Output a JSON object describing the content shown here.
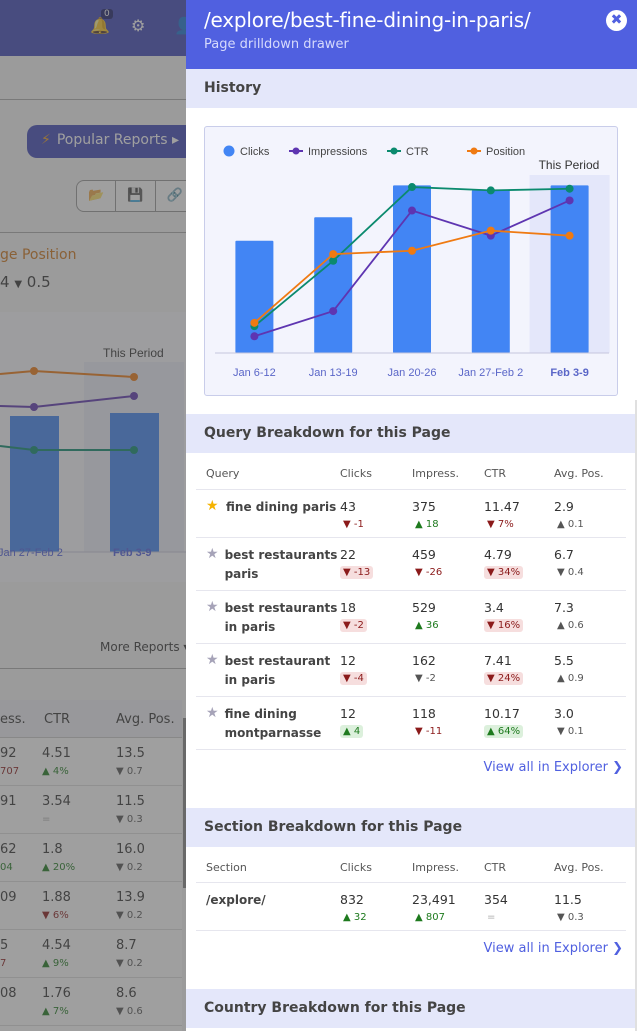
{
  "background": {
    "notifications_count": "0",
    "icons": [
      "bell-icon",
      "gear-icon",
      "user-icon"
    ],
    "popular_reports_label": "Popular Reports",
    "toolbar_icons": [
      "folder-open-icon",
      "save-icon",
      "link-icon"
    ],
    "avg_position_label": "ge Position",
    "avg_position_delta": "0.5",
    "chart": {
      "this_period_label": "This Period",
      "x_labels": [
        "Jan 27-Feb 2",
        "Feb 3-9"
      ]
    },
    "more_reports_label": "More Reports",
    "table": {
      "headers": [
        "ess.",
        "CTR",
        "Avg. Pos."
      ],
      "rows": [
        {
          "impress": "92",
          "impress_delta": "707",
          "ctr": "4.51",
          "ctr_delta": "4%",
          "ctr_dir": "up",
          "pos": "13.5",
          "pos_delta": "0.7"
        },
        {
          "impress": "91",
          "impress_delta": "",
          "ctr": "3.54",
          "ctr_delta": "=",
          "ctr_dir": "eq",
          "pos": "11.5",
          "pos_delta": "0.3"
        },
        {
          "impress": "62",
          "impress_delta": "04",
          "ctr": "1.8",
          "ctr_delta": "20%",
          "ctr_dir": "up",
          "pos": "16.0",
          "pos_delta": "0.2"
        },
        {
          "impress": "09",
          "impress_delta": "",
          "ctr": "1.88",
          "ctr_delta": "6%",
          "ctr_dir": "down",
          "pos": "13.9",
          "pos_delta": "0.2"
        },
        {
          "impress": "5",
          "impress_delta": "7",
          "ctr": "4.54",
          "ctr_delta": "9%",
          "ctr_dir": "up",
          "pos": "8.7",
          "pos_delta": "0.2"
        },
        {
          "impress": "08",
          "impress_delta": "",
          "ctr": "1.76",
          "ctr_delta": "7%",
          "ctr_dir": "up",
          "pos": "8.6",
          "pos_delta": "0.6"
        }
      ]
    }
  },
  "drawer": {
    "title": "/explore/best-fine-dining-in-paris/",
    "subtitle": "Page drilldown drawer",
    "close_icon": "close-circle-icon",
    "history": {
      "heading": "History"
    },
    "query_breakdown": {
      "heading": "Query Breakdown for this Page",
      "headers": [
        "Query",
        "Clicks",
        "Impress.",
        "CTR",
        "Avg. Pos."
      ],
      "rows": [
        {
          "query": "fine dining paris",
          "starred": true,
          "clicks": "43",
          "clicks_delta": "-1",
          "clicks_dir": "down",
          "clicks_hl": false,
          "impress": "375",
          "impress_delta": "18",
          "impress_dir": "up",
          "impress_hl": false,
          "ctr": "11.47",
          "ctr_delta": "7%",
          "ctr_dir": "down",
          "ctr_hl": false,
          "pos": "2.9",
          "pos_delta": "0.1",
          "pos_dir": "up"
        },
        {
          "query": "best restaurants paris",
          "starred": false,
          "clicks": "22",
          "clicks_delta": "-13",
          "clicks_dir": "down",
          "clicks_hl": true,
          "impress": "459",
          "impress_delta": "-26",
          "impress_dir": "down",
          "impress_hl": false,
          "ctr": "4.79",
          "ctr_delta": "34%",
          "ctr_dir": "down",
          "ctr_hl": true,
          "pos": "6.7",
          "pos_delta": "0.4",
          "pos_dir": "down"
        },
        {
          "query": "best restaurants in paris",
          "starred": false,
          "clicks": "18",
          "clicks_delta": "-2",
          "clicks_dir": "down",
          "clicks_hl": true,
          "impress": "529",
          "impress_delta": "36",
          "impress_dir": "up",
          "impress_hl": false,
          "ctr": "3.4",
          "ctr_delta": "16%",
          "ctr_dir": "down",
          "ctr_hl": true,
          "pos": "7.3",
          "pos_delta": "0.6",
          "pos_dir": "up"
        },
        {
          "query": "best restaurant in paris",
          "starred": false,
          "clicks": "12",
          "clicks_delta": "-4",
          "clicks_dir": "down",
          "clicks_hl": true,
          "impress": "162",
          "impress_delta": "-2",
          "impress_dir": "neutral",
          "impress_hl": false,
          "ctr": "7.41",
          "ctr_delta": "24%",
          "ctr_dir": "down",
          "ctr_hl": true,
          "pos": "5.5",
          "pos_delta": "0.9",
          "pos_dir": "up"
        },
        {
          "query": "fine dining montparnasse",
          "starred": false,
          "clicks": "12",
          "clicks_delta": "4",
          "clicks_dir": "up",
          "clicks_hl": true,
          "impress": "118",
          "impress_delta": "-11",
          "impress_dir": "down",
          "impress_hl": false,
          "ctr": "10.17",
          "ctr_delta": "64%",
          "ctr_dir": "up",
          "ctr_hl": true,
          "pos": "3.0",
          "pos_delta": "0.1",
          "pos_dir": "down"
        }
      ],
      "view_all": "View all in Explorer"
    },
    "section_breakdown": {
      "heading": "Section Breakdown for this Page",
      "headers": [
        "Section",
        "Clicks",
        "Impress.",
        "CTR",
        "Avg. Pos."
      ],
      "rows": [
        {
          "section": "/explore/",
          "clicks": "832",
          "clicks_delta": "32",
          "clicks_dir": "up",
          "impress": "23,491",
          "impress_delta": "807",
          "impress_dir": "up",
          "ctr": "354",
          "ctr_delta": "=",
          "ctr_dir": "eq",
          "pos": "11.5",
          "pos_delta": "0.3",
          "pos_dir": "down"
        }
      ],
      "view_all": "View all in Explorer"
    },
    "country_breakdown": {
      "heading": "Country Breakdown for this Page"
    }
  },
  "colors": {
    "drawer_header": "#5060e0",
    "clicks": "#4285f4",
    "impressions": "#5e35b1",
    "ctr": "#0b8a6e",
    "position": "#ef7a12",
    "up": "#1e7a1e",
    "down": "#8b1a1a"
  },
  "chart_data": {
    "type": "bar+line",
    "title": "History",
    "categories": [
      "Jan 6-12",
      "Jan 13-19",
      "Jan 20-26",
      "Jan 27-Feb 2",
      "Feb 3-9"
    ],
    "highlight_category": "Feb 3-9",
    "highlight_label": "This Period",
    "legend": [
      "Clicks",
      "Impressions",
      "CTR",
      "Position"
    ],
    "legend_position": "top-left",
    "series": [
      {
        "name": "Clicks",
        "type": "bar",
        "values": [
          0.67,
          0.81,
          1.0,
          0.97,
          1.0
        ]
      },
      {
        "name": "Impressions",
        "type": "line",
        "values": [
          0.1,
          0.25,
          0.85,
          0.7,
          0.91
        ]
      },
      {
        "name": "CTR",
        "type": "line",
        "values": [
          0.16,
          0.55,
          0.99,
          0.97,
          0.98
        ]
      },
      {
        "name": "Position",
        "type": "line",
        "values": [
          0.18,
          0.59,
          0.61,
          0.73,
          0.7
        ]
      }
    ],
    "value_units": "relative (normalized per series, no axis shown)",
    "ylim": [
      0,
      1.05
    ],
    "grid": false
  }
}
